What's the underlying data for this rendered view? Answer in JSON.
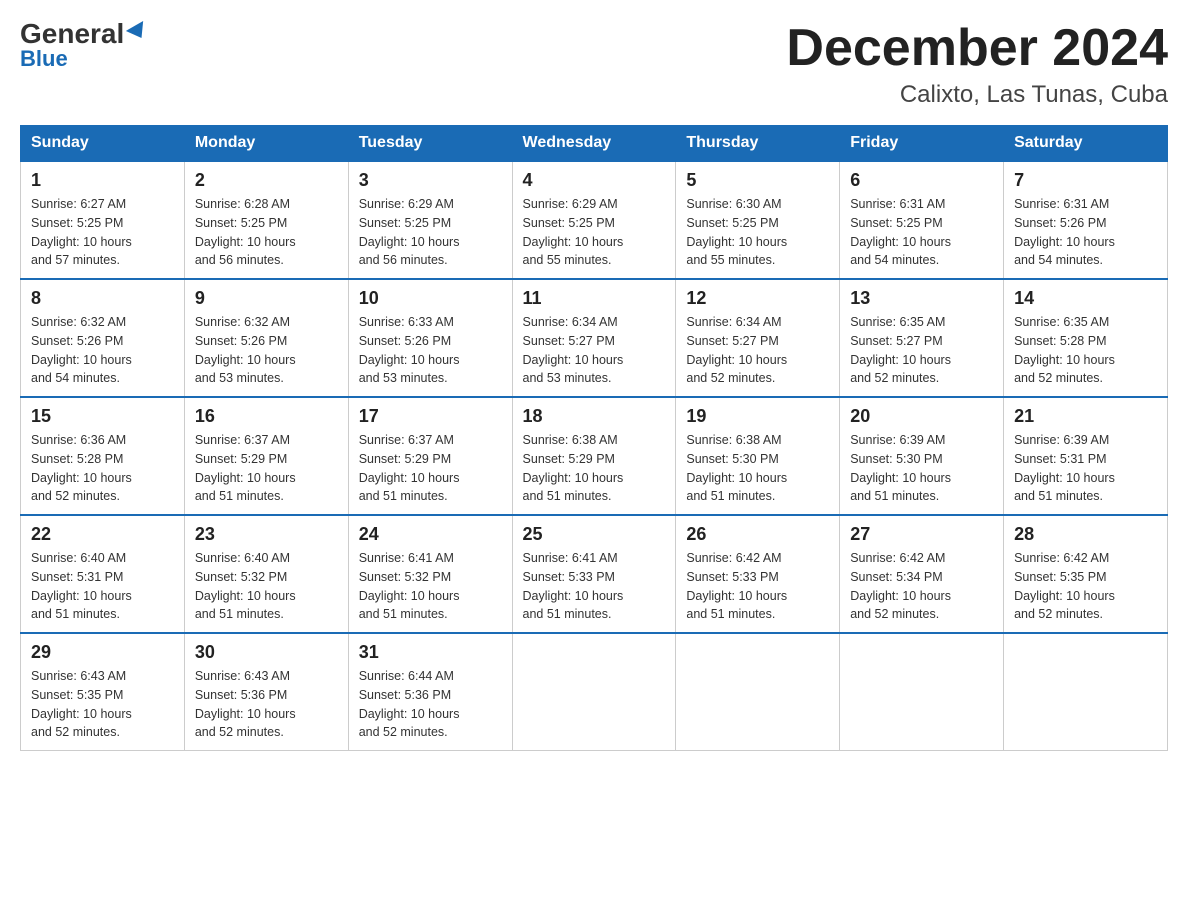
{
  "logo": {
    "general": "General",
    "blue": "Blue"
  },
  "title": "December 2024",
  "location": "Calixto, Las Tunas, Cuba",
  "days_of_week": [
    "Sunday",
    "Monday",
    "Tuesday",
    "Wednesday",
    "Thursday",
    "Friday",
    "Saturday"
  ],
  "weeks": [
    [
      {
        "day": "1",
        "sunrise": "6:27 AM",
        "sunset": "5:25 PM",
        "daylight": "10 hours and 57 minutes."
      },
      {
        "day": "2",
        "sunrise": "6:28 AM",
        "sunset": "5:25 PM",
        "daylight": "10 hours and 56 minutes."
      },
      {
        "day": "3",
        "sunrise": "6:29 AM",
        "sunset": "5:25 PM",
        "daylight": "10 hours and 56 minutes."
      },
      {
        "day": "4",
        "sunrise": "6:29 AM",
        "sunset": "5:25 PM",
        "daylight": "10 hours and 55 minutes."
      },
      {
        "day": "5",
        "sunrise": "6:30 AM",
        "sunset": "5:25 PM",
        "daylight": "10 hours and 55 minutes."
      },
      {
        "day": "6",
        "sunrise": "6:31 AM",
        "sunset": "5:25 PM",
        "daylight": "10 hours and 54 minutes."
      },
      {
        "day": "7",
        "sunrise": "6:31 AM",
        "sunset": "5:26 PM",
        "daylight": "10 hours and 54 minutes."
      }
    ],
    [
      {
        "day": "8",
        "sunrise": "6:32 AM",
        "sunset": "5:26 PM",
        "daylight": "10 hours and 54 minutes."
      },
      {
        "day": "9",
        "sunrise": "6:32 AM",
        "sunset": "5:26 PM",
        "daylight": "10 hours and 53 minutes."
      },
      {
        "day": "10",
        "sunrise": "6:33 AM",
        "sunset": "5:26 PM",
        "daylight": "10 hours and 53 minutes."
      },
      {
        "day": "11",
        "sunrise": "6:34 AM",
        "sunset": "5:27 PM",
        "daylight": "10 hours and 53 minutes."
      },
      {
        "day": "12",
        "sunrise": "6:34 AM",
        "sunset": "5:27 PM",
        "daylight": "10 hours and 52 minutes."
      },
      {
        "day": "13",
        "sunrise": "6:35 AM",
        "sunset": "5:27 PM",
        "daylight": "10 hours and 52 minutes."
      },
      {
        "day": "14",
        "sunrise": "6:35 AM",
        "sunset": "5:28 PM",
        "daylight": "10 hours and 52 minutes."
      }
    ],
    [
      {
        "day": "15",
        "sunrise": "6:36 AM",
        "sunset": "5:28 PM",
        "daylight": "10 hours and 52 minutes."
      },
      {
        "day": "16",
        "sunrise": "6:37 AM",
        "sunset": "5:29 PM",
        "daylight": "10 hours and 51 minutes."
      },
      {
        "day": "17",
        "sunrise": "6:37 AM",
        "sunset": "5:29 PM",
        "daylight": "10 hours and 51 minutes."
      },
      {
        "day": "18",
        "sunrise": "6:38 AM",
        "sunset": "5:29 PM",
        "daylight": "10 hours and 51 minutes."
      },
      {
        "day": "19",
        "sunrise": "6:38 AM",
        "sunset": "5:30 PM",
        "daylight": "10 hours and 51 minutes."
      },
      {
        "day": "20",
        "sunrise": "6:39 AM",
        "sunset": "5:30 PM",
        "daylight": "10 hours and 51 minutes."
      },
      {
        "day": "21",
        "sunrise": "6:39 AM",
        "sunset": "5:31 PM",
        "daylight": "10 hours and 51 minutes."
      }
    ],
    [
      {
        "day": "22",
        "sunrise": "6:40 AM",
        "sunset": "5:31 PM",
        "daylight": "10 hours and 51 minutes."
      },
      {
        "day": "23",
        "sunrise": "6:40 AM",
        "sunset": "5:32 PM",
        "daylight": "10 hours and 51 minutes."
      },
      {
        "day": "24",
        "sunrise": "6:41 AM",
        "sunset": "5:32 PM",
        "daylight": "10 hours and 51 minutes."
      },
      {
        "day": "25",
        "sunrise": "6:41 AM",
        "sunset": "5:33 PM",
        "daylight": "10 hours and 51 minutes."
      },
      {
        "day": "26",
        "sunrise": "6:42 AM",
        "sunset": "5:33 PM",
        "daylight": "10 hours and 51 minutes."
      },
      {
        "day": "27",
        "sunrise": "6:42 AM",
        "sunset": "5:34 PM",
        "daylight": "10 hours and 52 minutes."
      },
      {
        "day": "28",
        "sunrise": "6:42 AM",
        "sunset": "5:35 PM",
        "daylight": "10 hours and 52 minutes."
      }
    ],
    [
      {
        "day": "29",
        "sunrise": "6:43 AM",
        "sunset": "5:35 PM",
        "daylight": "10 hours and 52 minutes."
      },
      {
        "day": "30",
        "sunrise": "6:43 AM",
        "sunset": "5:36 PM",
        "daylight": "10 hours and 52 minutes."
      },
      {
        "day": "31",
        "sunrise": "6:44 AM",
        "sunset": "5:36 PM",
        "daylight": "10 hours and 52 minutes."
      },
      null,
      null,
      null,
      null
    ]
  ],
  "labels": {
    "sunrise": "Sunrise:",
    "sunset": "Sunset:",
    "daylight": "Daylight:"
  }
}
